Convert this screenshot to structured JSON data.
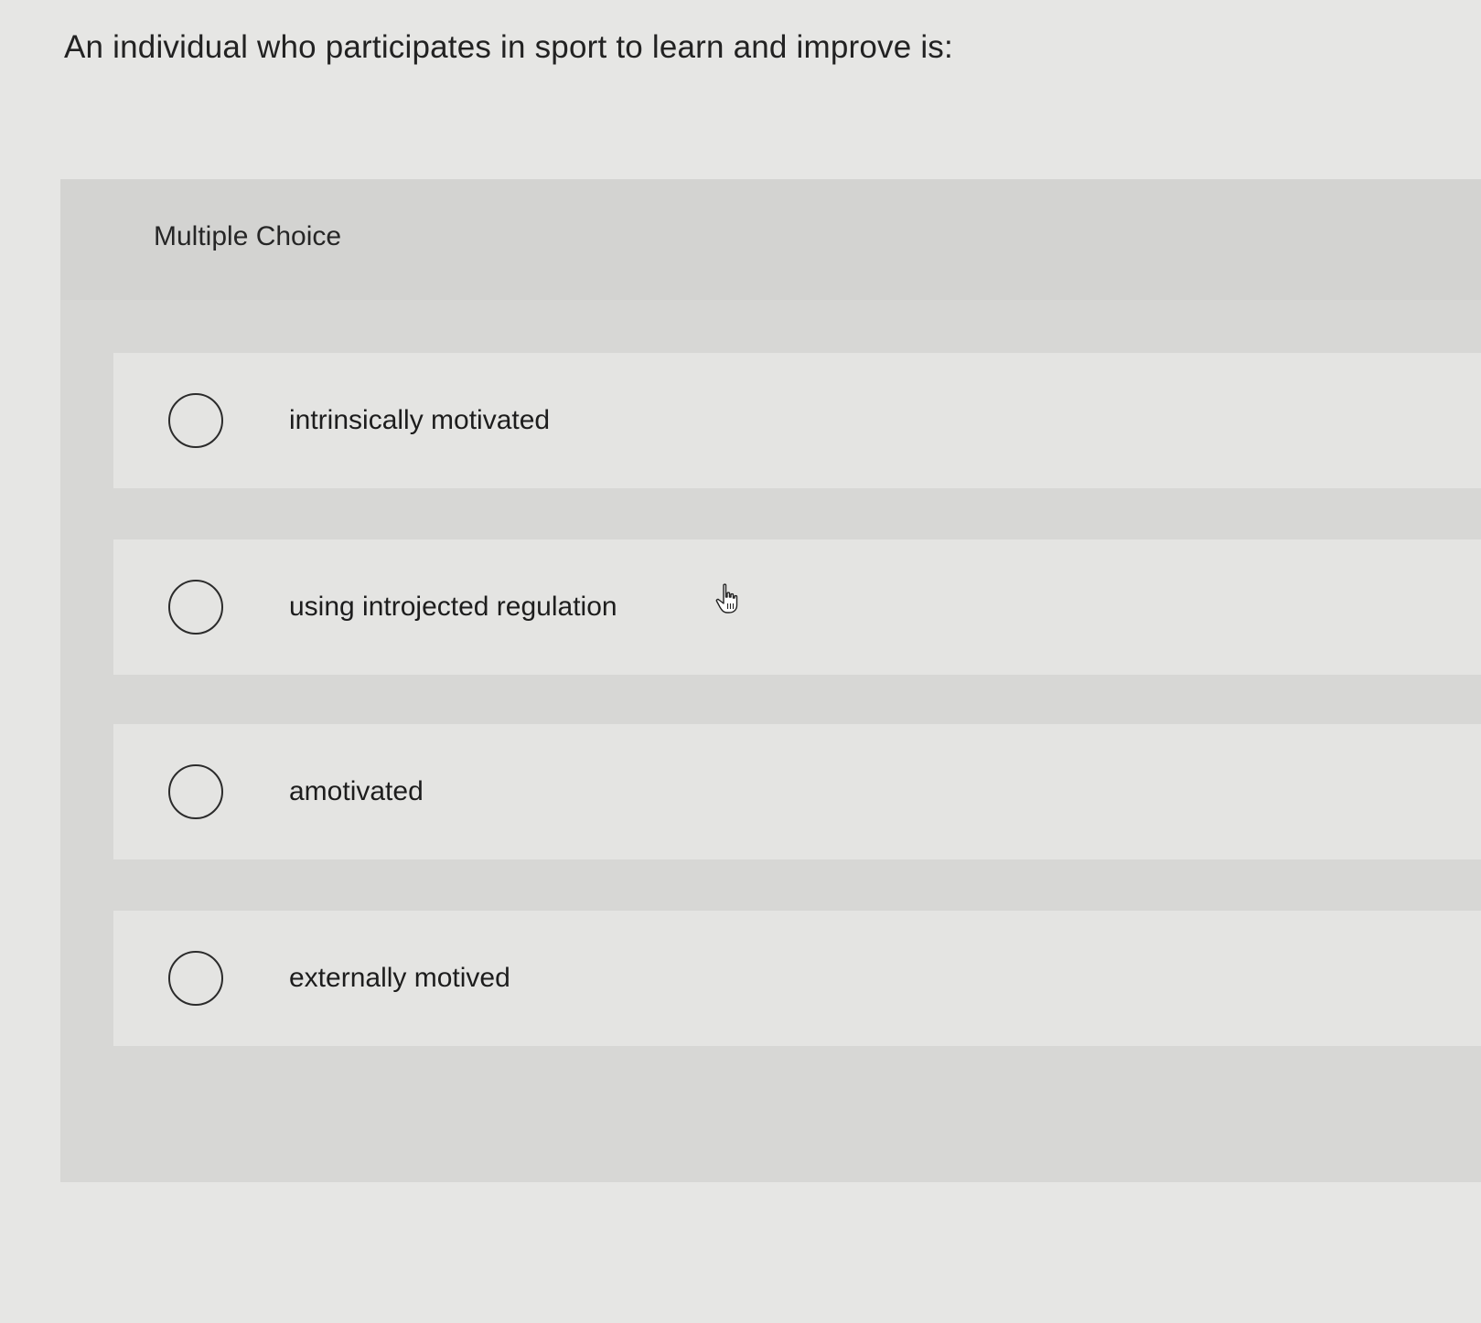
{
  "question": {
    "text": "An individual who participates in sport to learn and improve is:"
  },
  "panel": {
    "title": "Multiple Choice"
  },
  "options": [
    {
      "label": "intrinsically motivated",
      "selected": false
    },
    {
      "label": "using introjected regulation",
      "selected": false
    },
    {
      "label": "amotivated",
      "selected": false
    },
    {
      "label": "externally motived",
      "selected": false
    }
  ],
  "icons": {
    "radio": "radio-unchecked-icon",
    "cursor": "hand-pointer-icon"
  },
  "colors": {
    "page_background": "#e6e6e4",
    "panel_background": "#d7d7d5",
    "option_background": "#e4e4e2",
    "text": "#1f1f1f"
  }
}
